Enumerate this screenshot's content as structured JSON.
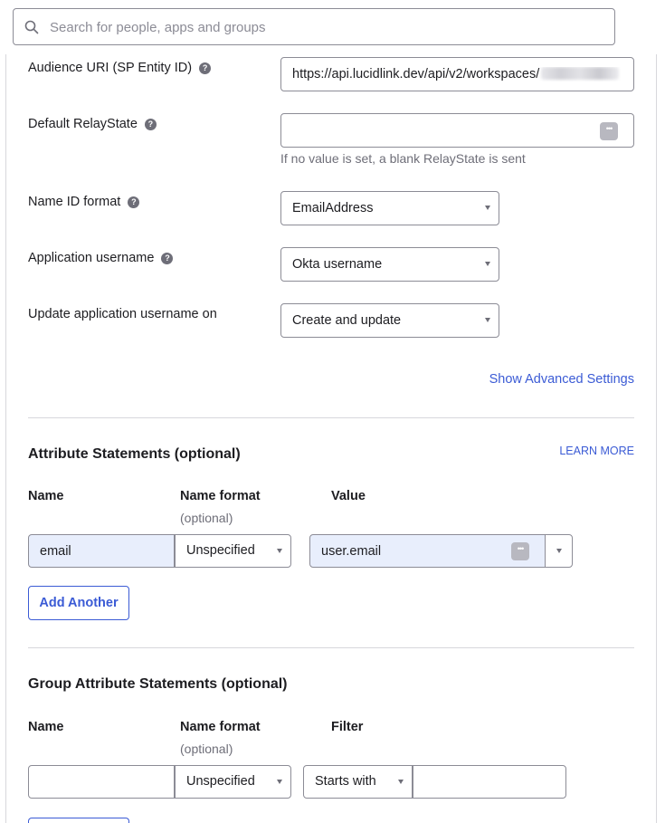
{
  "search": {
    "placeholder": "Search for people, apps and groups",
    "value": ""
  },
  "settings": {
    "audience_uri": {
      "label": "Audience URI (SP Entity ID)",
      "value": "https://api.lucidlink.dev/api/v2/workspaces/"
    },
    "relay_state": {
      "label": "Default RelayState",
      "value": "",
      "help_text": "If no value is set, a blank RelayState is sent"
    },
    "name_id_format": {
      "label": "Name ID format",
      "value": "EmailAddress"
    },
    "app_username": {
      "label": "Application username",
      "value": "Okta username"
    },
    "update_username_on": {
      "label": "Update application username on",
      "value": "Create and update"
    },
    "advanced_link": "Show Advanced Settings"
  },
  "attribute_statements": {
    "title": "Attribute Statements (optional)",
    "learn_more": "LEARN MORE",
    "columns": {
      "name": "Name",
      "name_format": "Name format",
      "name_format_sub": "(optional)",
      "value": "Value"
    },
    "rows": [
      {
        "name": "email",
        "name_format": "Unspecified",
        "value": "user.email"
      }
    ],
    "add_button": "Add Another"
  },
  "group_attribute_statements": {
    "title": "Group Attribute Statements (optional)",
    "columns": {
      "name": "Name",
      "name_format": "Name format",
      "name_format_sub": "(optional)",
      "filter": "Filter"
    },
    "rows": [
      {
        "name": "",
        "name_format": "Unspecified",
        "filter_type": "Starts with",
        "filter_value": ""
      }
    ]
  },
  "colors": {
    "accent": "#3b5bd5",
    "highlight": "#e8eefc",
    "border": "#8c8c96",
    "muted_text": "#6e6e78"
  }
}
